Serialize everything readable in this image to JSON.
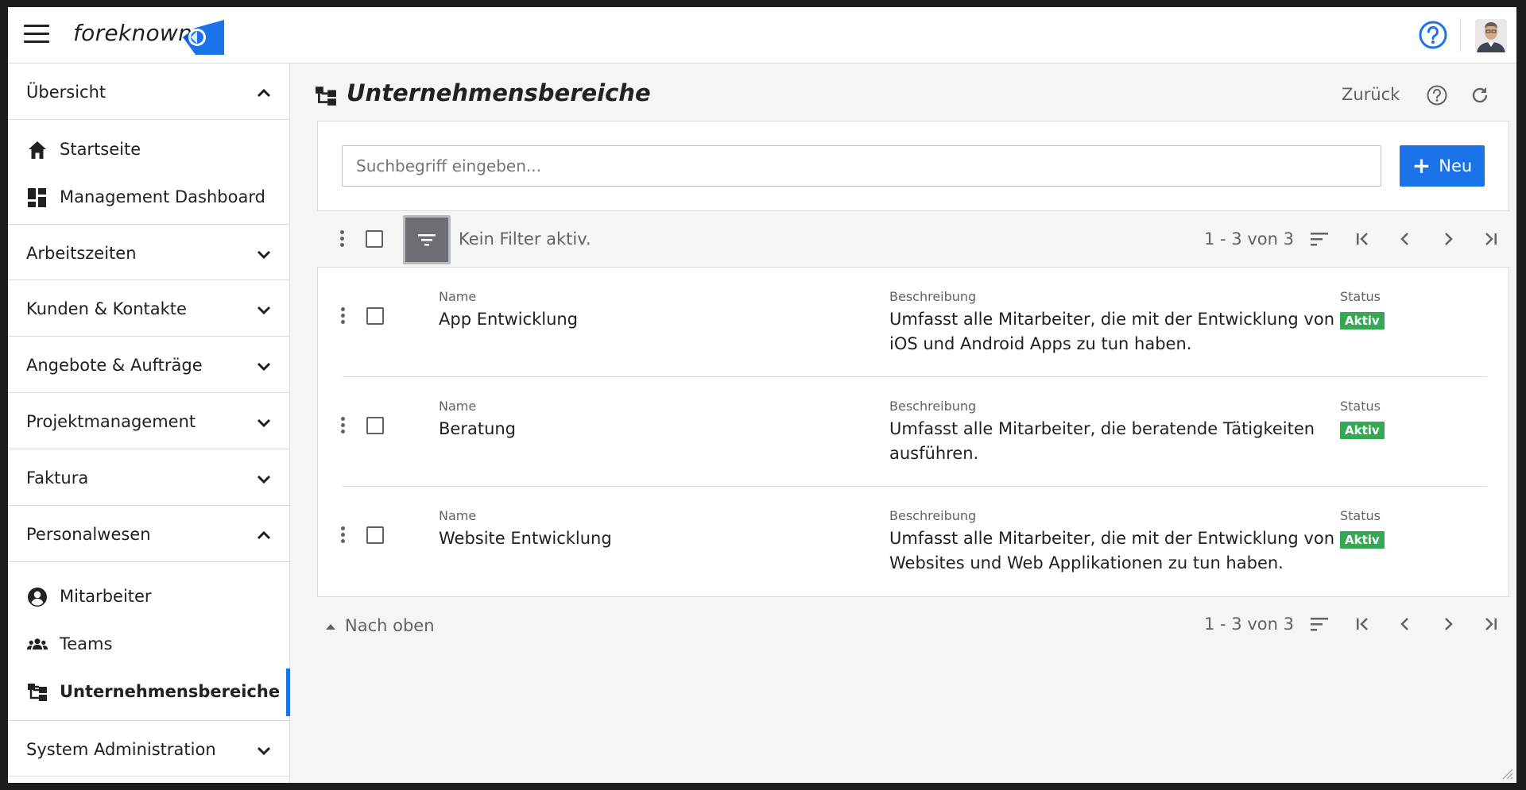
{
  "app": {
    "logo_text": "foreknown",
    "brand_color": "#1a73e8",
    "active_color": "#34a853"
  },
  "sidebar": {
    "sections": [
      {
        "label": "Übersicht",
        "expanded": true,
        "items": [
          {
            "label": "Startseite",
            "icon": "home-icon"
          },
          {
            "label": "Management Dashboard",
            "icon": "dashboard-icon"
          }
        ]
      },
      {
        "label": "Arbeitszeiten",
        "expanded": false
      },
      {
        "label": "Kunden & Kontakte",
        "expanded": false
      },
      {
        "label": "Angebote & Aufträge",
        "expanded": false
      },
      {
        "label": "Projektmanagement",
        "expanded": false
      },
      {
        "label": "Faktura",
        "expanded": false
      },
      {
        "label": "Personalwesen",
        "expanded": true,
        "items": [
          {
            "label": "Mitarbeiter",
            "icon": "account-circle-icon"
          },
          {
            "label": "Teams",
            "icon": "group-icon"
          },
          {
            "label": "Unternehmensbereiche",
            "icon": "org-tree-icon",
            "active": true
          }
        ]
      },
      {
        "label": "System Administration",
        "expanded": false
      }
    ]
  },
  "main": {
    "title": "Unternehmensbereiche",
    "back_label": "Zurück",
    "search": {
      "placeholder": "Suchbegriff eingeben...",
      "value": ""
    },
    "new_label": "Neu",
    "filter_text": "Kein Filter aktiv.",
    "pager_text": "1 - 3 von 3",
    "back_to_top": "Nach oben",
    "field_labels": {
      "name": "Name",
      "description": "Beschreibung",
      "status": "Status"
    },
    "rows": [
      {
        "name": "App Entwicklung",
        "description": [
          "Umfasst alle Mitarbeiter, die mit der Entwicklung von",
          "iOS und Android Apps zu tun haben."
        ],
        "status": "Aktiv"
      },
      {
        "name": "Beratung",
        "description": [
          "Umfasst alle Mitarbeiter, die beratende Tätigkeiten",
          "ausführen."
        ],
        "status": "Aktiv"
      },
      {
        "name": "Website Entwicklung",
        "description": [
          "Umfasst alle Mitarbeiter, die mit der Entwicklung von",
          "Websites und Web Applikationen zu tun haben."
        ],
        "status": "Aktiv"
      }
    ]
  }
}
